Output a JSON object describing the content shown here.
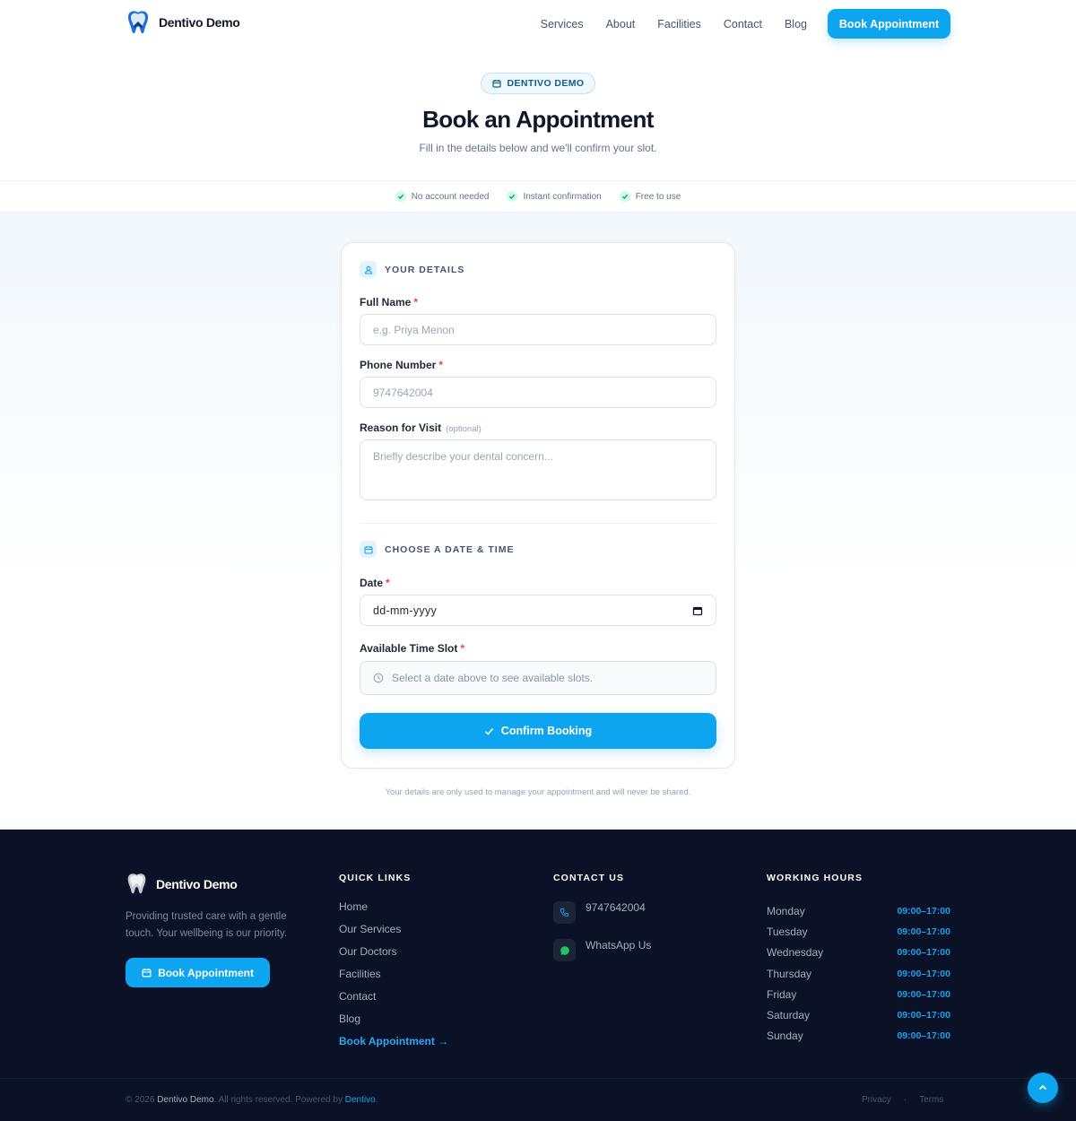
{
  "header": {
    "brand_name": "Dentivo Demo",
    "nav": [
      "Services",
      "About",
      "Facilities",
      "Contact",
      "Blog"
    ],
    "cta_label": "Book Appointment"
  },
  "hero": {
    "badge": "DENTIVO DEMO",
    "title": "Book an Appointment",
    "subtitle": "Fill in the details below and we'll confirm your slot.",
    "features": [
      "No account needed",
      "Instant confirmation",
      "Free to use"
    ]
  },
  "form": {
    "details_title": "YOUR DETAILS",
    "full_name_label": "Full Name",
    "full_name_placeholder": "e.g. Priya Menon",
    "phone_label": "Phone Number",
    "phone_placeholder": "9747642004",
    "reason_label": "Reason for Visit",
    "reason_optional": "(optional)",
    "reason_placeholder": "Briefly describe your dental concern...",
    "datetime_title": "CHOOSE A DATE & TIME",
    "date_label": "Date",
    "date_placeholder": "dd-mm-yyyy",
    "slot_label": "Available Time Slot",
    "slot_hint": "Select a date above to see available slots.",
    "required_mark": "*",
    "submit_label": "Confirm Booking",
    "privacy_note": "Your details are only used to manage your appointment and will never be shared."
  },
  "footer": {
    "brand_name": "Dentivo Demo",
    "description": "Providing trusted care with a gentle touch. Your wellbeing is our priority.",
    "cta_label": "Book Appointment",
    "quick_links_title": "QUICK LINKS",
    "quick_links": [
      "Home",
      "Our Services",
      "Our Doctors",
      "Facilities",
      "Contact",
      "Blog"
    ],
    "quick_links_cta": "Book Appointment →",
    "contact_title": "CONTACT US",
    "phone": "9747642004",
    "whatsapp": "WhatsApp Us",
    "hours_title": "WORKING HOURS",
    "hours": [
      {
        "day": "Monday",
        "time": "09:00–17:00"
      },
      {
        "day": "Tuesday",
        "time": "09:00–17:00"
      },
      {
        "day": "Wednesday",
        "time": "09:00–17:00"
      },
      {
        "day": "Thursday",
        "time": "09:00–17:00"
      },
      {
        "day": "Friday",
        "time": "09:00–17:00"
      },
      {
        "day": "Saturday",
        "time": "09:00–17:00"
      },
      {
        "day": "Sunday",
        "time": "09:00–17:00"
      }
    ],
    "copyright_prefix": "© 2026",
    "copyright_brand": "Dentivo Demo",
    "copyright_mid": ". All rights reserved. Powered by",
    "copyright_powered": "Dentivo",
    "copyright_end": ".",
    "privacy": "Privacy",
    "separator": "·",
    "terms": "Terms"
  },
  "colors": {
    "accent": "#0ea5f0",
    "footer_bg": "#0b1227",
    "whatsapp_green": "#22c55e",
    "required_red": "#ef4444"
  },
  "icons": [
    "tooth-logo-icon",
    "calendar-icon",
    "check-circle-icon",
    "user-icon",
    "clock-icon",
    "check-icon",
    "phone-icon",
    "whatsapp-icon",
    "arrow-up-icon"
  ]
}
